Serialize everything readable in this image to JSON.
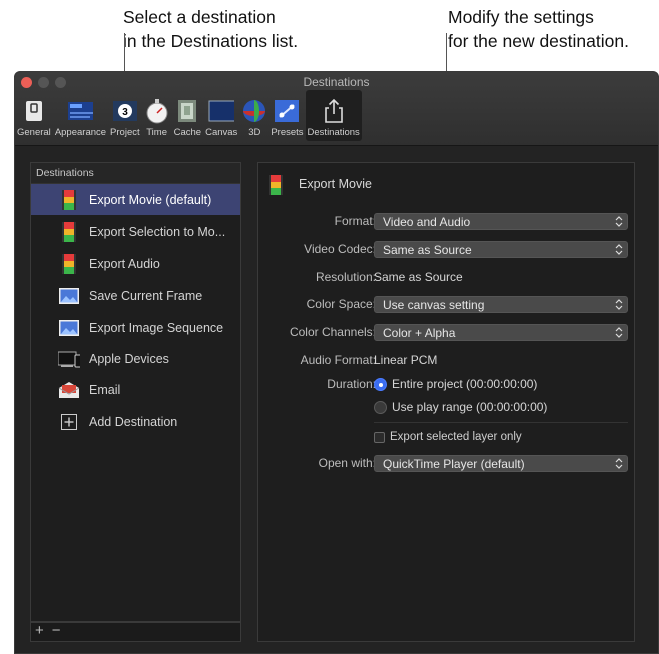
{
  "callouts": {
    "left": "Select a destination\nin the Destinations list.",
    "right": "Modify the settings\nfor the new destination."
  },
  "window": {
    "title": "Destinations"
  },
  "toolbar": {
    "items": [
      {
        "label": "General",
        "icon": "switch-icon"
      },
      {
        "label": "Appearance",
        "icon": "appearance-icon"
      },
      {
        "label": "Project",
        "icon": "project-icon"
      },
      {
        "label": "Time",
        "icon": "stopwatch-icon"
      },
      {
        "label": "Cache",
        "icon": "cache-icon"
      },
      {
        "label": "Canvas",
        "icon": "canvas-icon"
      },
      {
        "label": "3D",
        "icon": "globe-3d-icon"
      },
      {
        "label": "Presets",
        "icon": "presets-icon"
      },
      {
        "label": "Destinations",
        "icon": "share-icon"
      }
    ],
    "active": "Destinations"
  },
  "sidebar": {
    "header": "Destinations",
    "items": [
      {
        "label": "Export Movie (default)",
        "icon": "film-icon",
        "selected": true
      },
      {
        "label": "Export Selection to Mo...",
        "icon": "film-icon"
      },
      {
        "label": "Export Audio",
        "icon": "film-icon"
      },
      {
        "label": "Save Current Frame",
        "icon": "image-icon"
      },
      {
        "label": "Export Image Sequence",
        "icon": "image-icon"
      },
      {
        "label": "Apple Devices",
        "icon": "devices-icon"
      },
      {
        "label": "Email",
        "icon": "email-icon"
      },
      {
        "label": "Add Destination",
        "icon": "plus-icon"
      }
    ],
    "footer": {
      "add": "+",
      "remove": "−"
    }
  },
  "settings": {
    "title": "Export Movie",
    "format": {
      "label": "Format:",
      "value": "Video and Audio"
    },
    "video_codec": {
      "label": "Video Codec:",
      "value": "Same as Source"
    },
    "resolution": {
      "label": "Resolution:",
      "value": "Same as Source"
    },
    "color_space": {
      "label": "Color Space:",
      "value": "Use canvas setting"
    },
    "color_channels": {
      "label": "Color Channels:",
      "value": "Color + Alpha"
    },
    "audio_format": {
      "label": "Audio Format:",
      "value": "Linear PCM"
    },
    "duration": {
      "label": "Duration:",
      "option1": "Entire project (00:00:00:00)",
      "option2": "Use play range (00:00:00:00)",
      "selected": "option1"
    },
    "export_selected_layer": {
      "label": "Export selected layer only",
      "checked": false
    },
    "open_with": {
      "label": "Open with:",
      "value": "QuickTime Player (default)"
    }
  },
  "colors": {
    "selection": "#3d4473",
    "radio_on": "#3b6df0",
    "close_button": "#ec5f57",
    "window_bg": "#232323"
  }
}
